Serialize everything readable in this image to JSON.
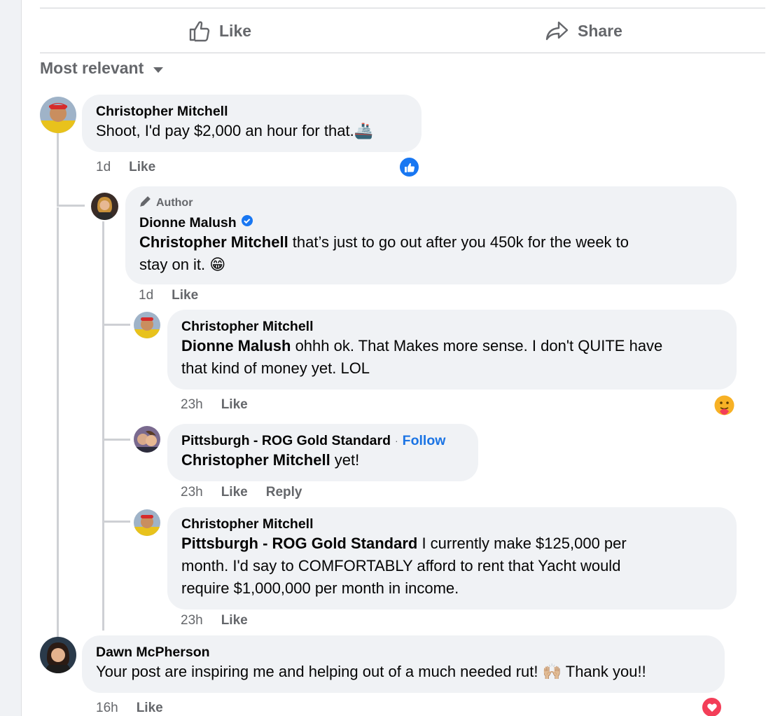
{
  "post_actions": {
    "like_label": "Like",
    "share_label": "Share"
  },
  "sort": {
    "label": "Most relevant"
  },
  "comments": [
    {
      "author": "Christopher Mitchell",
      "text": "Shoot, I'd pay $2,000 an hour for that.",
      "emoji": "🚢",
      "time": "1d",
      "like": "Like",
      "reaction": "like-reaction-icon"
    },
    {
      "badge": "Author",
      "author": "Dionne Malush",
      "verified": true,
      "mention": "Christopher Mitchell",
      "text_line1": " that’s just to go out after you 450k for the week to",
      "text_line2": "stay on it.",
      "emoji": "😁",
      "time": "1d",
      "like": "Like"
    },
    {
      "author": "Christopher Mitchell",
      "mention": "Dionne Malush",
      "text_line1": " ohhh ok. That Makes more sense. I don't QUITE have",
      "text_line2": "that kind of money yet. LOL",
      "time": "23h",
      "like": "Like",
      "reaction": "care-reaction-icon"
    },
    {
      "author": "Pittsburgh - ROG Gold Standard",
      "separator": "·",
      "follow": "Follow",
      "mention": "Christopher Mitchell",
      "text": " yet!",
      "time": "23h",
      "like": "Like",
      "reply": "Reply"
    },
    {
      "author": "Christopher Mitchell",
      "mention": "Pittsburgh - ROG Gold Standard",
      "text_line1": " I currently make $125,000 per",
      "text_line2": "month. I'd say to COMFORTABLY afford to rent that Yacht would",
      "text_line3": "require $1,000,000 per month in income.",
      "time": "23h",
      "like": "Like"
    },
    {
      "author": "Dawn McPherson",
      "text": "Your post are inspiring me and helping out of a much needed rut!",
      "emoji": "🙌🏼",
      "text_after": "Thank you!!",
      "time": "16h",
      "like": "Like",
      "reaction": "love-reaction-icon"
    }
  ],
  "colors": {
    "bubble": "#f0f2f5",
    "secondary_text": "#65676b",
    "link_blue": "#1b74e4",
    "like_blue": "#1877f2",
    "love_red": "#f33e58"
  }
}
